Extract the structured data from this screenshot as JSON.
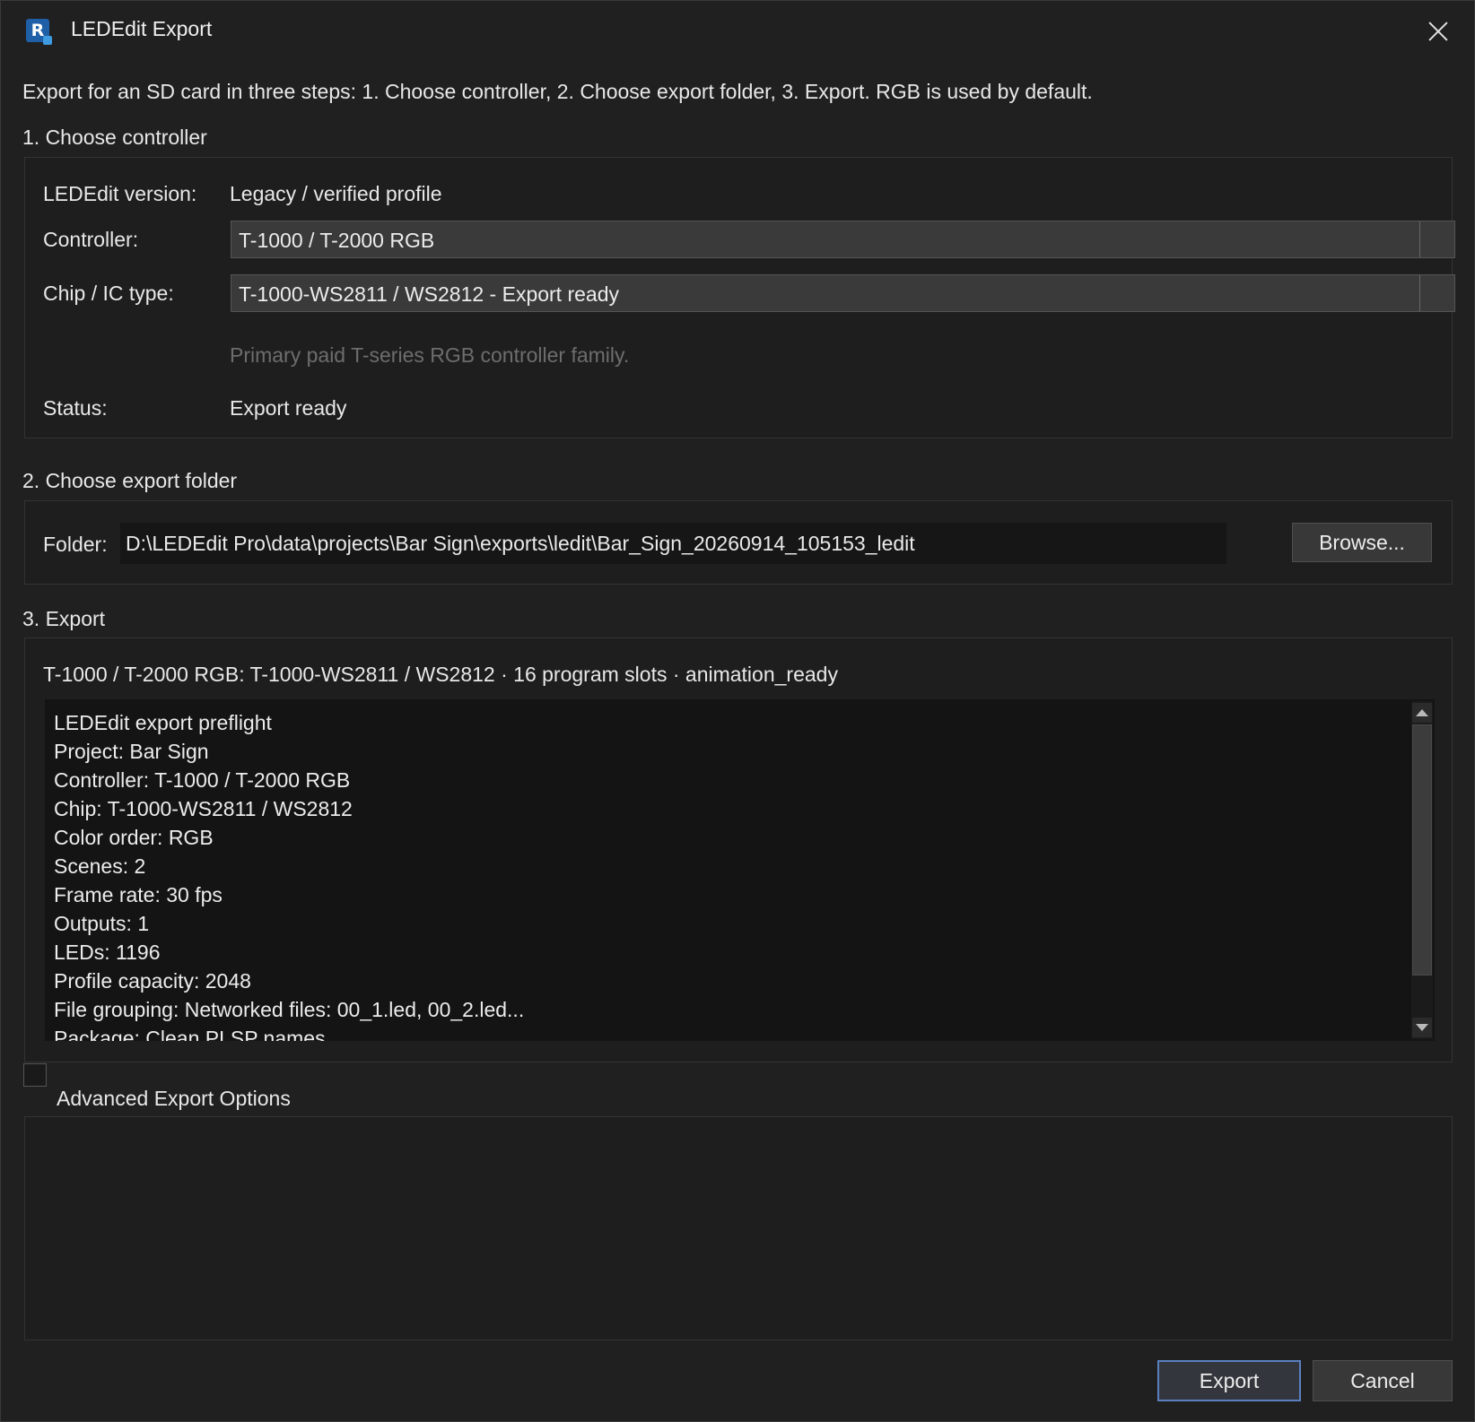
{
  "window": {
    "title": "LEDEdit Export",
    "app_icon_glyph": "R"
  },
  "intro": "Export for an SD card in three steps: 1. Choose controller, 2. Choose export folder, 3. Export. RGB is used by default.",
  "step1": {
    "title": "1. Choose controller",
    "version_label": "LEDEdit version:",
    "version_value": "Legacy / verified profile",
    "controller_label": "Controller:",
    "controller_value": "T-1000 / T-2000 RGB",
    "chip_label": "Chip / IC type:",
    "chip_value": "T-1000-WS2811 / WS2812 - Export ready",
    "hint": "Primary paid T-series RGB controller family.",
    "status_label": "Status:",
    "status_value": "Export ready"
  },
  "step2": {
    "title": "2. Choose export folder",
    "folder_label": "Folder:",
    "folder_value": "D:\\LEDEdit Pro\\data\\projects\\Bar Sign\\exports\\ledit\\Bar_Sign_20260914_105153_ledit",
    "browse_label": "Browse..."
  },
  "step3": {
    "title": "3. Export",
    "summary": "T-1000 / T-2000 RGB: T-1000-WS2811 / WS2812 · 16 program slots · animation_ready",
    "preflight": "LEDEdit export preflight\nProject: Bar Sign\nController: T-1000 / T-2000 RGB\nChip: T-1000-WS2811 / WS2812\nColor order: RGB\nScenes: 2\nFrame rate: 30 fps\nOutputs: 1\nLEDs: 1196\nProfile capacity: 2048\nFile grouping: Networked files: 00_1.led, 00_2.led...\nPackage: Clean PLSP names"
  },
  "advanced": {
    "label": "Advanced Export Options",
    "checked": false
  },
  "buttons": {
    "export": "Export",
    "cancel": "Cancel"
  },
  "colors": {
    "accent_border": "#5a7fc0",
    "background": "#202020",
    "panel": "#1e1e1e"
  }
}
